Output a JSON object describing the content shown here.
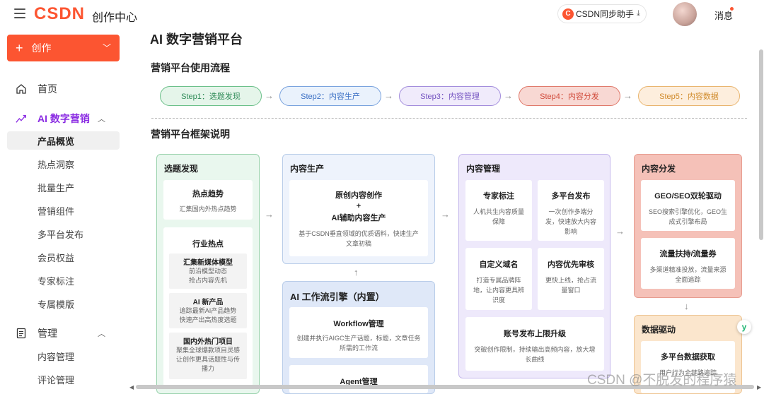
{
  "header": {
    "logo": "CSDN",
    "center_title": "创作中心",
    "assistant_label": "CSDN同步助手",
    "assistant_icon": "C",
    "messages_label": "消息"
  },
  "sidebar": {
    "create_label": "创作",
    "items": [
      {
        "label": "首页",
        "icon": "home-icon"
      },
      {
        "label": "AI 数字营销",
        "icon": "trend-icon"
      },
      {
        "label": "产品概览"
      },
      {
        "label": "热点洞察"
      },
      {
        "label": "批量生产"
      },
      {
        "label": "营销组件"
      },
      {
        "label": "多平台发布"
      },
      {
        "label": "会员权益"
      },
      {
        "label": "专家标注"
      },
      {
        "label": "专属模版"
      },
      {
        "label": "管理",
        "icon": "document-icon"
      },
      {
        "label": "内容管理"
      },
      {
        "label": "评论管理"
      }
    ]
  },
  "main": {
    "title": "AI 数字营销平台",
    "flow_title": "营销平台使用流程",
    "steps": [
      {
        "label": "Step1：选题发现",
        "color": "#2e8b57"
      },
      {
        "label": "Step2：内容生产",
        "color": "#3a6fc4"
      },
      {
        "label": "Step3：内容管理",
        "color": "#7352c0"
      },
      {
        "label": "Step4：内容分发",
        "color": "#d04a3a"
      },
      {
        "label": "Step5：内容数据",
        "color": "#d08a2a"
      }
    ],
    "framework_title": "营销平台框架说明",
    "col1": {
      "title": "选题发现",
      "card1": {
        "title": "热点趋势",
        "desc": "汇集国内外热点趋势"
      },
      "card2": {
        "title": "行业热点"
      },
      "subs": [
        {
          "title": "汇集新媒体模型",
          "desc1": "前沿模型动态",
          "desc2": "抢占内容先机"
        },
        {
          "title": "AI 新产品",
          "desc1": "追踪最新AI产品趋势",
          "desc2": "快速产出高热度选题"
        },
        {
          "title": "国内外热门项目",
          "desc1": "聚集全球爆款项目灵感",
          "desc2": "让创作更具话题性与传",
          "desc3": "播力"
        }
      ]
    },
    "col2": {
      "title": "内容生产",
      "card": {
        "line1": "原创内容创作",
        "line2": "+",
        "line3": "AI辅助内容生产",
        "desc1": "基于CSDN垂直领域的优质语料，快速生产",
        "desc2": "文章初稿"
      }
    },
    "col2b": {
      "title": "AI 工作流引擎（内置）",
      "card1": {
        "title": "Workflow管理",
        "desc1": "创建并执行AIGC生产话题，标题，文章任务",
        "desc2": "所需的工作流"
      },
      "card2": {
        "title": "Agent管理"
      }
    },
    "col3": {
      "title": "内容管理",
      "cards": [
        {
          "title": "专家标注",
          "desc1": "人机共生内容质量",
          "desc2": "保障",
          "desc3": ""
        },
        {
          "title": "多平台发布",
          "desc1": "一次创作多端分",
          "desc2": "发，快速放大内容",
          "desc3": "影响"
        },
        {
          "title": "自定义域名",
          "desc1": "打造专属品牌阵",
          "desc2": "地，让内容更具辨",
          "desc3": "识度"
        },
        {
          "title": "内容优先审核",
          "desc1": "更快上线，抢占流",
          "desc2": "量窗口",
          "desc3": ""
        }
      ],
      "wide": {
        "title": "账号发布上限升级",
        "desc1": "突破创作限制，持续输出高频内容，放大增",
        "desc2": "长曲线"
      }
    },
    "col4": {
      "title": "内容分发",
      "card1": {
        "title": "GEO/SEO双轮驱动",
        "desc1": "SEO搜索引擎优化，GEO生",
        "desc2": "成式引擎布局"
      },
      "card2": {
        "title": "流量扶持/流量券",
        "desc1": "多渠道精准投放，流量来源",
        "desc2": "全面追踪"
      }
    },
    "col5": {
      "title": "数据驱动",
      "card1": {
        "title": "多平台数据获取",
        "desc1": "用户行为全链路追踪"
      }
    }
  },
  "watermark": "CSDN @不脱发的程序猿",
  "float_icon": "y"
}
